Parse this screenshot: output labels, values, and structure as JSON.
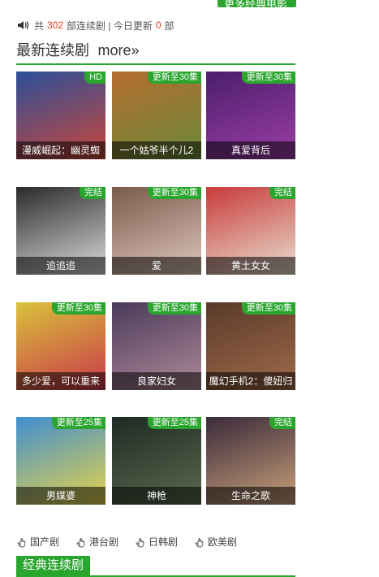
{
  "top_button": {
    "label": "更多经典电影"
  },
  "stats": {
    "prefix": "共",
    "total": "302",
    "mid": "部连续剧 | 今日更新",
    "today": "0",
    "suffix": "部"
  },
  "section": {
    "title": "最新连续剧",
    "more": "more»"
  },
  "cards": [
    {
      "title": "漫威崛起：幽灵蜘",
      "badge": "HD",
      "colors": [
        "#2b4f9a",
        "#c9473a"
      ]
    },
    {
      "title": "一个姑爷半个儿2",
      "badge": "更新至30集",
      "colors": [
        "#b56c2e",
        "#6b8a3c"
      ]
    },
    {
      "title": "真爱背后",
      "badge": "更新至30集",
      "colors": [
        "#4b1e6a",
        "#9c3ea7"
      ]
    },
    {
      "title": "追追追",
      "badge": "完结",
      "colors": [
        "#2a2a2a",
        "#dcdcdc"
      ]
    },
    {
      "title": "爱",
      "badge": "更新至30集",
      "colors": [
        "#7a5a4a",
        "#e0c7bd"
      ]
    },
    {
      "title": "黄土女女",
      "badge": "完结",
      "colors": [
        "#c93a3a",
        "#e8e0d0"
      ]
    },
    {
      "title": "多少爱，可以重来",
      "badge": "更新至30集",
      "colors": [
        "#d9c23b",
        "#c9384a"
      ]
    },
    {
      "title": "良家妇女",
      "badge": "更新至30集",
      "colors": [
        "#4a3a5a",
        "#b08a9a"
      ]
    },
    {
      "title": "魔幻手机2：傻妞归",
      "badge": "更新至30集",
      "colors": [
        "#5a3a2a",
        "#a06a4a"
      ]
    },
    {
      "title": "男媒婆",
      "badge": "更新至25集",
      "colors": [
        "#3f8fd0",
        "#e6d24a"
      ]
    },
    {
      "title": "神枪",
      "badge": "更新至25集",
      "colors": [
        "#1e2a24",
        "#5a6b4e"
      ]
    },
    {
      "title": "生命之歌",
      "badge": "完结",
      "colors": [
        "#3a2a3a",
        "#c9a07a"
      ]
    }
  ],
  "categories": [
    "国产剧",
    "港台剧",
    "日韩剧",
    "欧美剧"
  ],
  "section2": {
    "title": "经典连续剧"
  }
}
